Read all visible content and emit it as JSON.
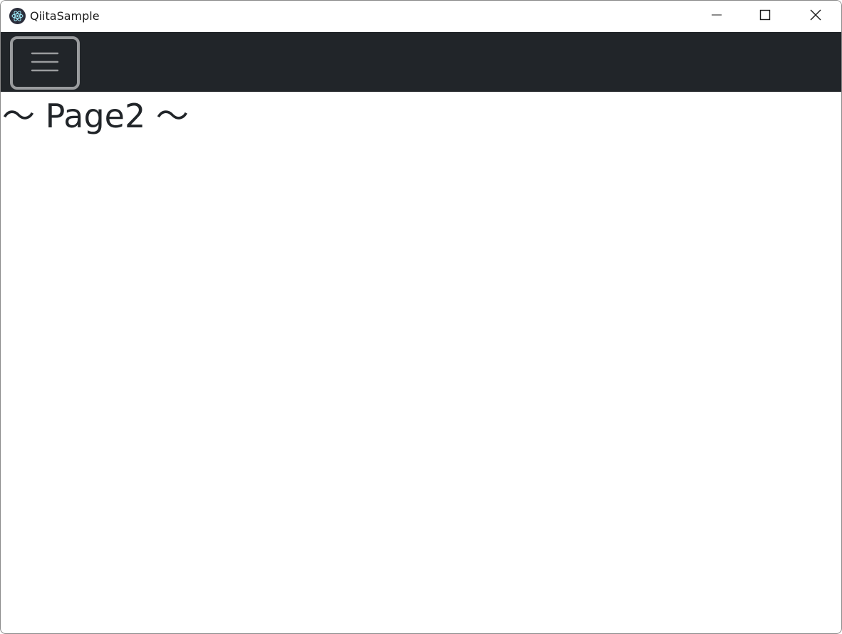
{
  "window": {
    "title": "QiitaSample",
    "app_icon": "electron-atom-icon",
    "controls": {
      "minimize_icon": "minimize-icon",
      "maximize_icon": "maximize-icon",
      "close_icon": "close-icon"
    }
  },
  "navbar": {
    "background_color": "#212529",
    "toggler_icon": "hamburger-menu-icon"
  },
  "main": {
    "heading": "～ Page2 ～"
  }
}
